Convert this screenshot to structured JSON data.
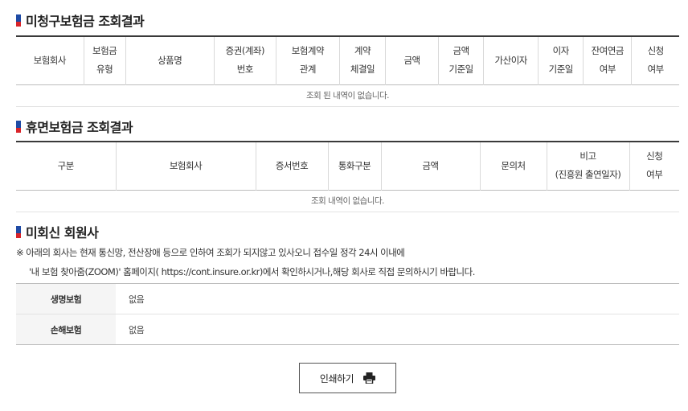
{
  "unclaimed": {
    "title": "미청구보험금 조회결과",
    "columns": [
      [
        "보험회사"
      ],
      [
        "보험금",
        "유형"
      ],
      [
        "상품명"
      ],
      [
        "증권(계좌)",
        "번호"
      ],
      [
        "보험계약",
        "관계"
      ],
      [
        "계약",
        "체결일"
      ],
      [
        "금액"
      ],
      [
        "금액",
        "기준일"
      ],
      [
        "가산이자"
      ],
      [
        "이자",
        "기준일"
      ],
      [
        "잔여연금",
        "여부"
      ],
      [
        "신청",
        "여부"
      ]
    ],
    "empty_message": "조회 된 내역이 없습니다."
  },
  "dormant": {
    "title": "휴면보험금 조회결과",
    "columns": [
      [
        "구분"
      ],
      [
        "보험회사"
      ],
      [
        "증서번호"
      ],
      [
        "통화구분"
      ],
      [
        "금액"
      ],
      [
        "문의처"
      ],
      [
        "비고",
        "(진흥원 출연일자)"
      ],
      [
        "신청",
        "여부"
      ]
    ],
    "empty_message": "조회 내역이 없습니다."
  },
  "nonresponding": {
    "title": "미회신 회원사",
    "notice_line1": "※ 아래의 회사는 현재 통신망, 전산장애 등으로 인하여 조회가 되지않고 있사오니 접수일 정각 24시 이내에",
    "notice_line2": "'내 보험 찾아줌(ZOOM)' 홈페이지( https://cont.insure.or.kr)에서 확인하시거나,해당 회사로 직접 문의하시기 바랍니다.",
    "rows": [
      {
        "label": "생명보험",
        "value": "없음"
      },
      {
        "label": "손해보험",
        "value": "없음"
      }
    ]
  },
  "print_button": {
    "label": "인쇄하기",
    "icon": "printer-icon"
  },
  "colors": {
    "title_mark_blue": "#1f4ba5",
    "title_mark_red": "#d9242a",
    "table_top_border": "#3a3a3a"
  }
}
